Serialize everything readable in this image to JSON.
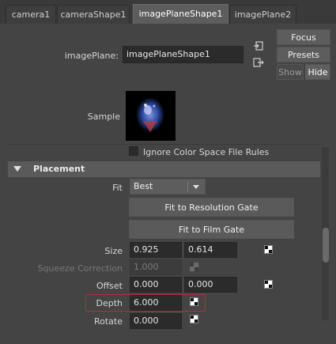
{
  "tabs": [
    {
      "label": "camera1",
      "active": false
    },
    {
      "label": "cameraShape1",
      "active": false
    },
    {
      "label": "imagePlaneShape1",
      "active": true
    },
    {
      "label": "imagePlane2",
      "active": false
    }
  ],
  "header": {
    "image_plane_label": "imagePlane:",
    "image_plane_value": "imagePlaneShape1",
    "focus_label": "Focus",
    "presets_label": "Presets",
    "show_label": "Show",
    "hide_label": "Hide"
  },
  "sample": {
    "label": "Sample"
  },
  "ignore_color_space": {
    "label": "Ignore Color Space File Rules",
    "checked": false
  },
  "placement": {
    "section_title": "Placement",
    "fit_label": "Fit",
    "fit_value": "Best",
    "fit_resolution_gate_label": "Fit to Resolution Gate",
    "fit_film_gate_label": "Fit to Film Gate",
    "size_label": "Size",
    "size_x": "0.925",
    "size_y": "0.614",
    "squeeze_label": "Squeeze Correction",
    "squeeze_value": "1.000",
    "offset_label": "Offset",
    "offset_x": "0.000",
    "offset_y": "0.000",
    "depth_label": "Depth",
    "depth_value": "6.000",
    "rotate_label": "Rotate",
    "rotate_value": "0.000"
  },
  "colors": {
    "background": "#444444",
    "field": "#2b2b2b",
    "button": "#5d5d5d",
    "highlight": "#b0303a"
  }
}
